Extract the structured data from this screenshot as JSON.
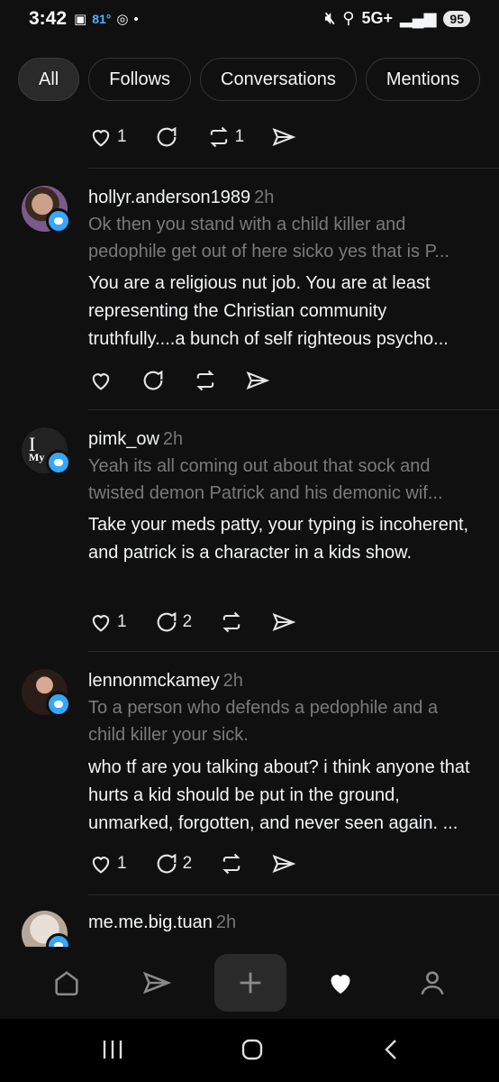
{
  "status": {
    "time": "3:42",
    "temp": "81°",
    "network": "5G+",
    "battery": "95"
  },
  "tabs": [
    "All",
    "Follows",
    "Conversations",
    "Mentions"
  ],
  "top_actions": {
    "likes": "1",
    "replies": "",
    "reposts": "1"
  },
  "posts": [
    {
      "username": "hollyr.anderson1989",
      "time": "2h",
      "quote": "Ok then you stand with a child killer and pedophile get out of here sicko yes that is P...",
      "body": "You are a religious nut job. You are at least representing the Christian community truthfully....a bunch of self righteous psycho...",
      "likes": "",
      "replies": ""
    },
    {
      "username": "pimk_ow",
      "time": "2h",
      "quote": "Yeah its all coming out about that sock and twisted demon Patrick and his demonic wif...",
      "body": "Take your meds patty, your typing is incoherent, and patrick is a character in a kids show.",
      "likes": "1",
      "replies": "2"
    },
    {
      "username": "lennonmckamey",
      "time": "2h",
      "quote": "To a person who defends a pedophile and a child killer your sick.",
      "body": "who tf are you talking about? i think anyone that hurts a kid should be put in the ground, unmarked, forgotten, and never seen again. ...",
      "likes": "1",
      "replies": "2"
    },
    {
      "username": "me.me.big.tuan",
      "time": "2h"
    }
  ],
  "avatar_text": {
    "pimk": "I",
    "pimk_sub": "My"
  }
}
